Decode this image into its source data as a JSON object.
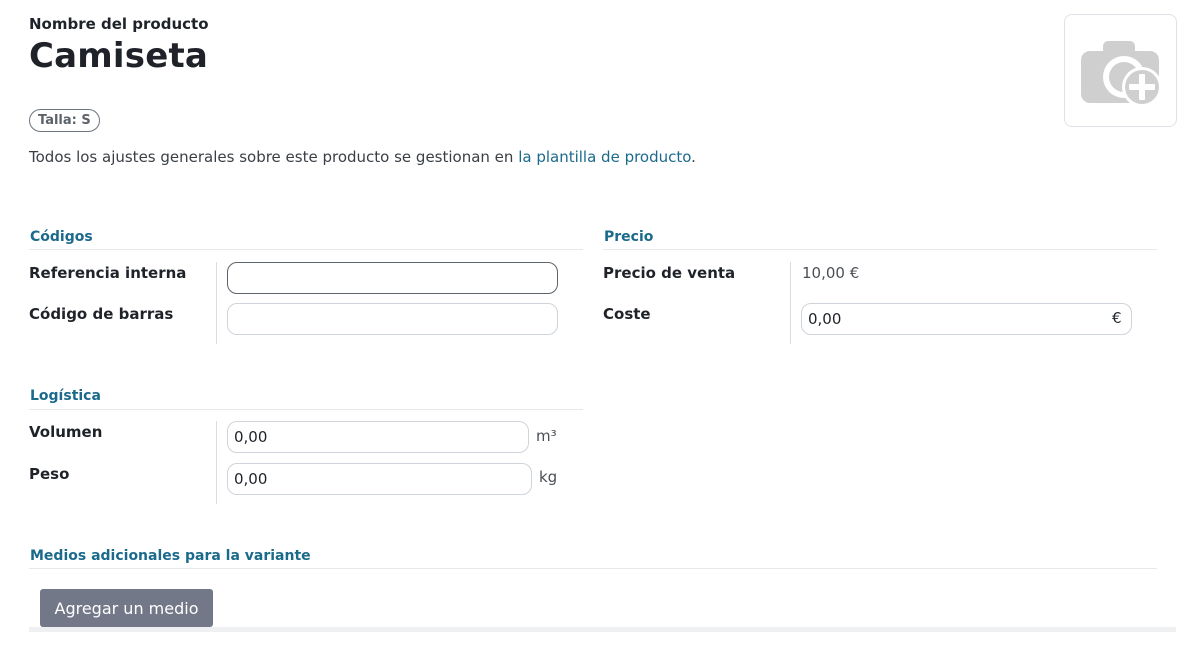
{
  "header": {
    "name_label": "Nombre del producto",
    "product_name": "Camiseta",
    "image_icon": "camera-plus-icon"
  },
  "tags": {
    "attribute": "Talla: S"
  },
  "info": {
    "text": "Todos los ajustes generales sobre este producto se gestionan en ",
    "link_text": "la plantilla de producto",
    "suffix": "."
  },
  "codes": {
    "title": "Códigos",
    "internal_ref_label": "Referencia interna",
    "internal_ref_value": "",
    "barcode_label": "Código de barras",
    "barcode_value": ""
  },
  "price": {
    "title": "Precio",
    "sale_price_label": "Precio de venta",
    "sale_price_value": "10,00 €",
    "cost_label": "Coste",
    "cost_value": "0,00",
    "currency": "€"
  },
  "logistics": {
    "title": "Logística",
    "volume_label": "Volumen",
    "volume_value": "0,00",
    "volume_unit": "m³",
    "weight_label": "Peso",
    "weight_value": "0,00",
    "weight_unit": "kg"
  },
  "media": {
    "title": "Medios adicionales para la variante",
    "add_button": "Agregar un medio"
  },
  "colors": {
    "accent": "#1b6a8c",
    "button": "#737888"
  }
}
